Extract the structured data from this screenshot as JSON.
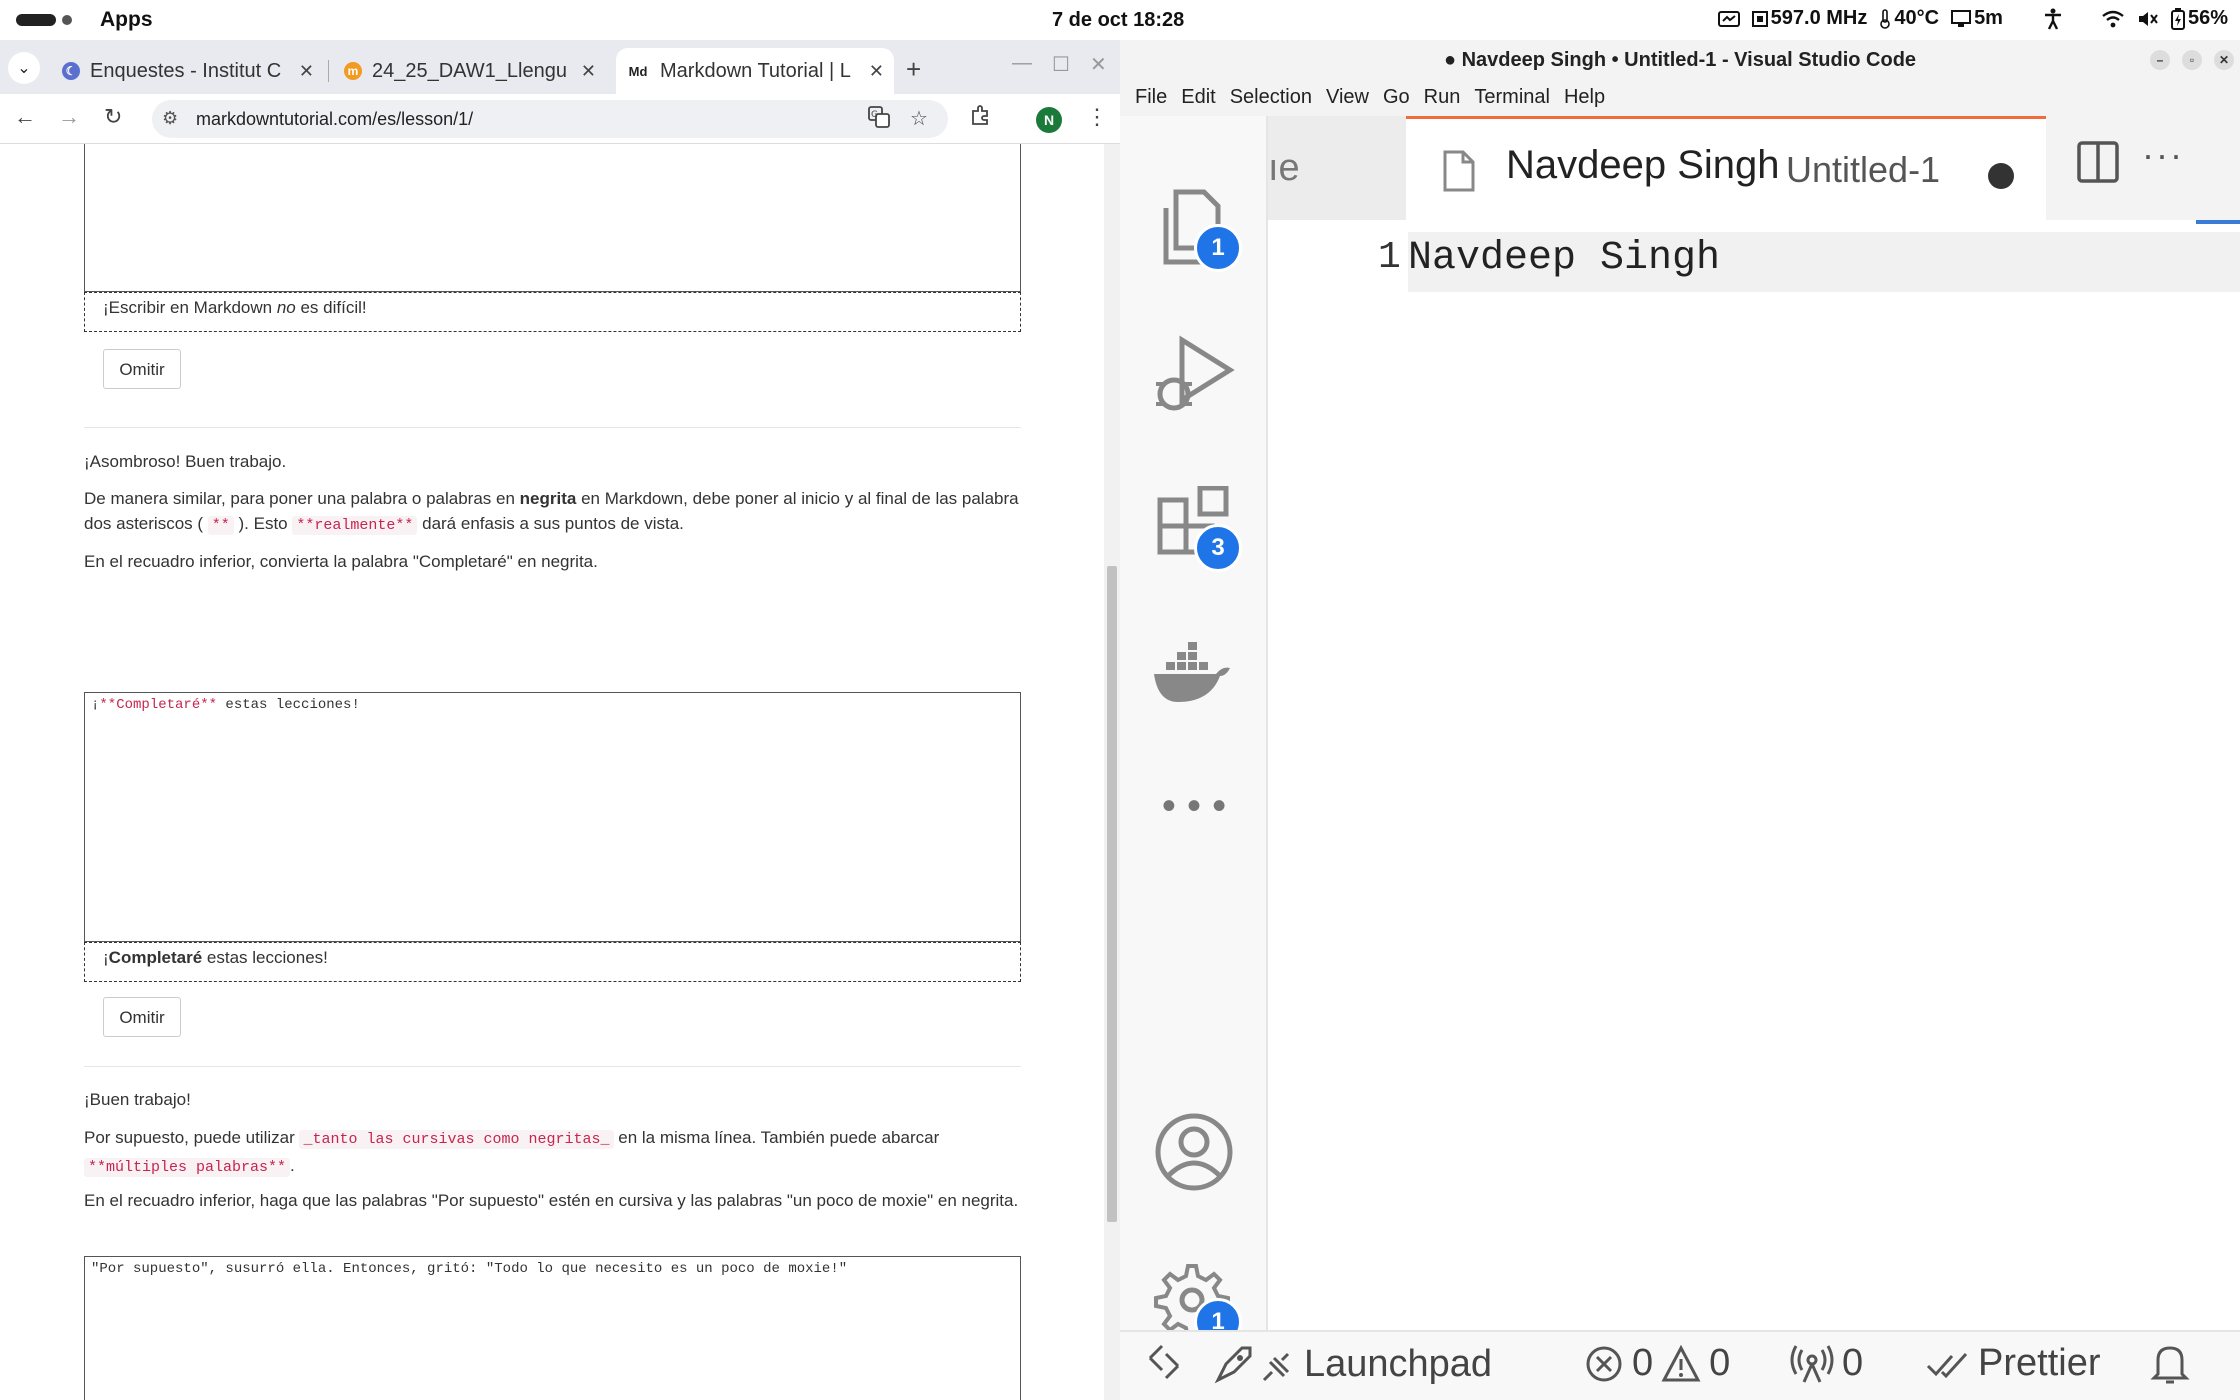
{
  "topbar": {
    "apps_label": "Apps",
    "clock": "7 de oct  18:28",
    "cpu_freq": "597.0 MHz",
    "temperature": "40°C",
    "screen_time": "5m",
    "battery": "56%"
  },
  "browser": {
    "tabs": [
      {
        "title": "Enquestes - Institut C",
        "active": false
      },
      {
        "title": "24_25_DAW1_Llengu",
        "active": false
      },
      {
        "title": "Markdown Tutorial | L",
        "active": true
      }
    ],
    "url": "markdowntutorial.com/es/lesson/1/",
    "profile_initial": "N"
  },
  "lesson": {
    "preview1": {
      "pre": "¡Escribir en Markdown ",
      "em": "no",
      "post": " es difícil!"
    },
    "omit_label": "Omitir",
    "praise1": "¡Asombroso! Buen trabajo.",
    "bold_intro": {
      "p1": "De manera similar, para poner una palabra o palabras en ",
      "strong": "negrita",
      "p2": " en Markdown, debe poner al inicio y al final de las palabra dos asteriscos ( ",
      "code1": "**",
      "p3": " ). Esto ",
      "code2": "**realmente**",
      "p4": " dará enfasis a sus puntos de vista."
    },
    "instruction2": "En el recuadro inferior, convierta la palabra \"Completaré\" en negrita.",
    "editor2": {
      "pre": "¡",
      "hl": "**Completaré**",
      "post": " estas lecciones!"
    },
    "preview2": {
      "pre": "¡",
      "strong": "Completaré",
      "post": " estas lecciones!"
    },
    "praise2": "¡Buen trabajo!",
    "both_intro": {
      "p1": "Por supuesto, puede utilizar ",
      "code1": "_tanto las cursivas como negritas_",
      "p2": " en la misma línea. También puede abarcar ",
      "code2": "**múltiples palabras**",
      "p3": "."
    },
    "instruction3": "En el recuadro inferior, haga que las palabras \"Por supuesto\" estén en cursiva y las palabras \"un poco de moxie\" en negrita.",
    "editor3": "\"Por supuesto\", susurró ella. Entonces, gritó: \"Todo lo que necesito es un poco de moxie!\""
  },
  "vscode": {
    "window_title": "● Navdeep Singh • Untitled-1 - Visual Studio Code",
    "menu": [
      "File",
      "Edit",
      "Selection",
      "View",
      "Go",
      "Run",
      "Terminal",
      "Help"
    ],
    "prev_tab_fragment": "ıe",
    "active_tab": {
      "name": "Navdeep Singh",
      "sub": "Untitled-1"
    },
    "badges": {
      "explorer": "1",
      "extensions": "3",
      "settings": "1"
    },
    "line_number": "1",
    "line_text": "Navdeep Singh",
    "status": {
      "launchpad": "Launchpad",
      "errors": "0",
      "warnings": "0",
      "ports": "0",
      "prettier": "Prettier"
    }
  },
  "colors": {
    "accent_blue": "#1f75e8",
    "tab_active_border": "#f26b3a",
    "code_pink": "#c7254e"
  }
}
